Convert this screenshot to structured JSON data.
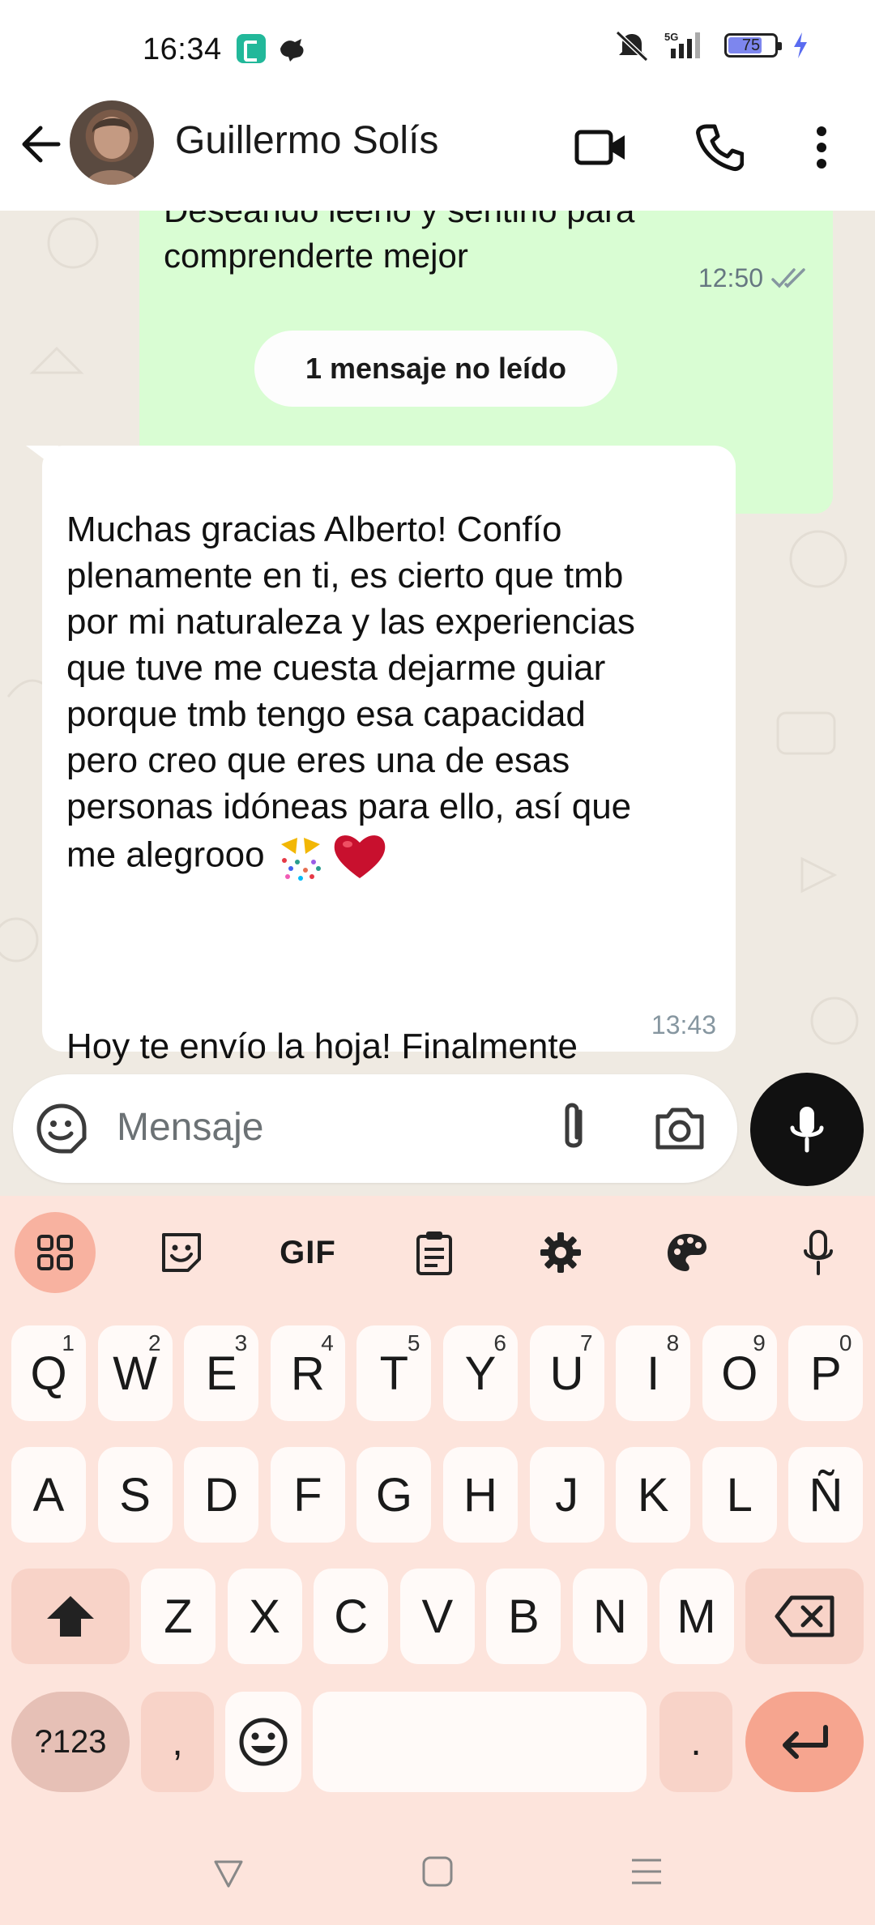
{
  "status_bar": {
    "time": "16:34",
    "network": "5G",
    "battery_level": "75",
    "battery_fraction": 0.75
  },
  "header": {
    "contact_name": "Guillermo Solís",
    "icons": [
      "back-arrow-icon",
      "video-call-icon",
      "voice-call-icon",
      "more-options-icon"
    ]
  },
  "chat": {
    "outgoing": {
      "text_line1": "Deseando leerlo y sentirlo para",
      "text_line2": "comprenderte mejor",
      "time": "12:50",
      "status_icon": "double-check-icon"
    },
    "unread_divider": "1 mensaje no leído",
    "incoming": {
      "text_main": "Muchas gracias Alberto! Confío\nplenamente en ti, es cierto que tmb\npor mi naturaleza y las experiencias\nque tuve me cuesta dejarme guiar\nporque tmb tengo esa capacidad\npero creo que eres una de esas\npersonas idóneas para ello, así que\nme alegrooo",
      "emojis": [
        "party-popper-icon",
        "red-heart-icon"
      ],
      "text_after": "Hoy te envío la hoja! Finalmente\nhemos comenzado!",
      "time": "13:43"
    }
  },
  "composer": {
    "placeholder": "Mensaje"
  },
  "keyboard": {
    "toolbar": [
      "apps-grid-icon",
      "sticker-icon",
      "GIF",
      "clipboard-icon",
      "settings-icon",
      "palette-icon",
      "mic-icon"
    ],
    "row1": [
      {
        "k": "Q",
        "h": "1"
      },
      {
        "k": "W",
        "h": "2"
      },
      {
        "k": "E",
        "h": "3"
      },
      {
        "k": "R",
        "h": "4"
      },
      {
        "k": "T",
        "h": "5"
      },
      {
        "k": "Y",
        "h": "6"
      },
      {
        "k": "U",
        "h": "7"
      },
      {
        "k": "I",
        "h": "8"
      },
      {
        "k": "O",
        "h": "9"
      },
      {
        "k": "P",
        "h": "0"
      }
    ],
    "row2": [
      "A",
      "S",
      "D",
      "F",
      "G",
      "H",
      "J",
      "K",
      "L",
      "Ñ"
    ],
    "row3": [
      "Z",
      "X",
      "C",
      "V",
      "B",
      "N",
      "M"
    ],
    "symbols_label": "?123",
    "comma": ",",
    "period": "."
  }
}
